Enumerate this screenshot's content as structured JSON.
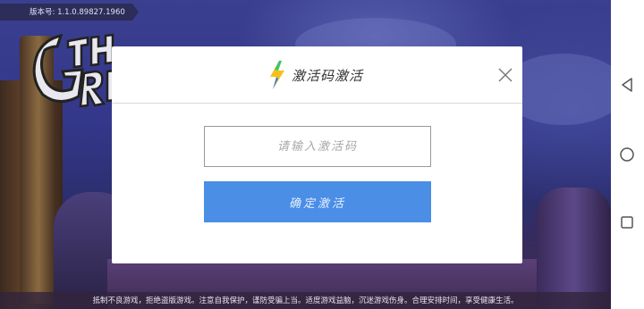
{
  "version": {
    "text": "版本号: 1.1.0.89827.1960"
  },
  "dialog": {
    "title": "激活码激活",
    "input_placeholder": "请输入激活码",
    "input_value": "",
    "confirm_label": "确定激活",
    "close_icon": "close-icon",
    "logo_icon": "lightning-bolt-icon"
  },
  "notice": {
    "text": "抵制不良游戏，拒绝盗版游戏。注意自我保护，谨防受骗上当。适度游戏益脑，沉迷游戏伤身。合理安排时间，享受健康生活。"
  },
  "nav": {
    "back_icon": "back-triangle-icon",
    "home_icon": "home-circle-icon",
    "recents_icon": "recents-square-icon"
  },
  "colors": {
    "accent": "#4a8ee6",
    "dialog_bg": "#ffffff",
    "background": "#34378a"
  }
}
